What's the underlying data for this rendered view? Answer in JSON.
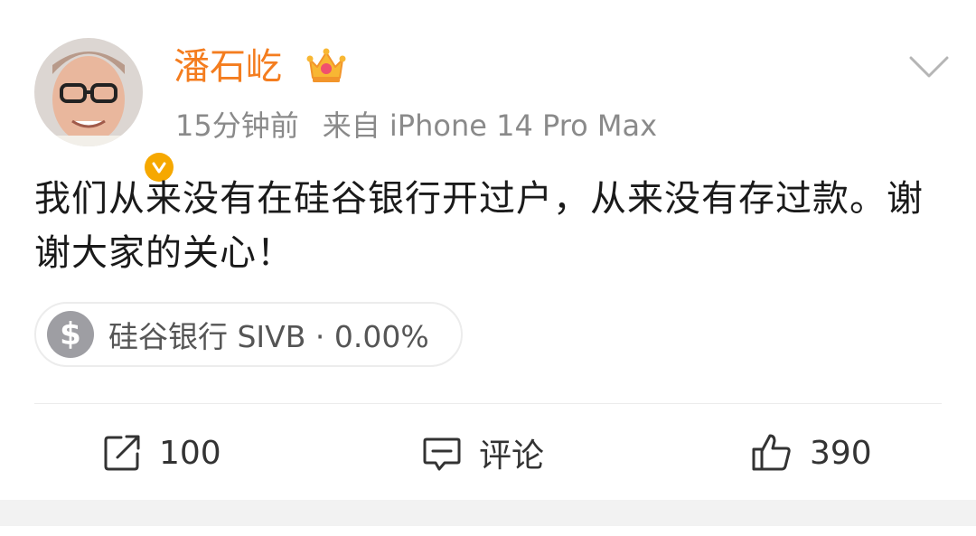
{
  "post": {
    "username": "潘石屹",
    "time_ago": "15分钟前",
    "source": "来自 iPhone 14 Pro Max",
    "content": "我们从来没有在硅谷银行开过户，从来没有存过款。谢谢大家的关心！",
    "stock_chip": {
      "symbol_glyph": "$",
      "label": "硅谷银行 SIVB · 0.00%"
    }
  },
  "actions": {
    "repost_count": "100",
    "comment_label": "评论",
    "like_count": "390"
  },
  "colors": {
    "username": "#f47d1f",
    "verified_badge": "#f6a800",
    "meta_text": "#8a8a8a"
  },
  "icons": {
    "vip_badge": "crown-icon",
    "verified": "verified-badge-icon",
    "menu": "chevron-down-icon",
    "repost": "repost-icon",
    "comment": "comment-icon",
    "like": "thumbs-up-icon"
  }
}
